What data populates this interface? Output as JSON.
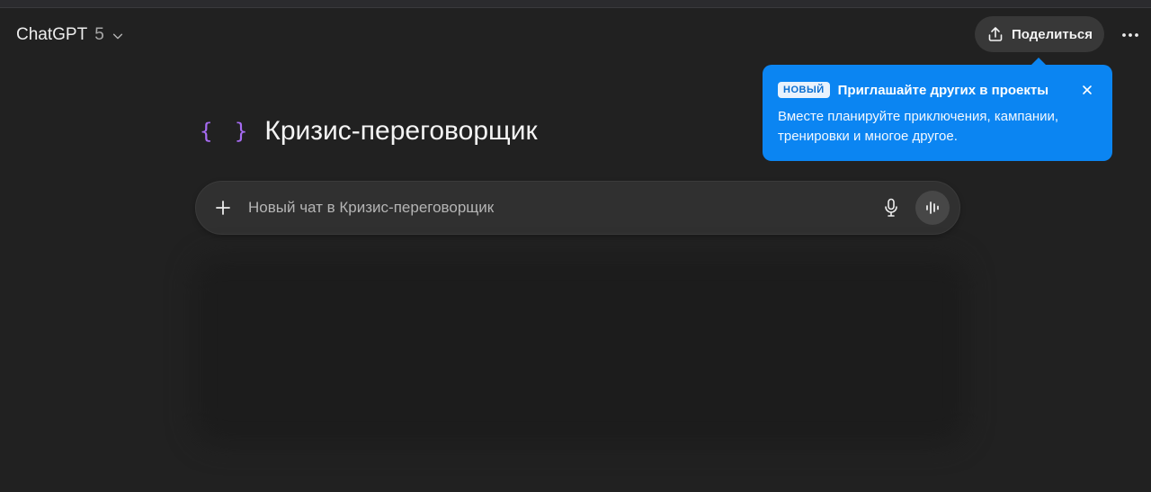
{
  "header": {
    "model_name": "ChatGPT",
    "model_version": "5",
    "share_label": "Поделиться",
    "icons": {
      "chevron": "chevron-down-icon",
      "share": "share-upload-icon",
      "more": "more-horizontal-icon"
    }
  },
  "tooltip": {
    "badge": "НОВЫЙ",
    "title": "Приглашайте других в проекты",
    "body": "Вместе планируйте приключения, кампании, тренировки и многое другое.",
    "bg_color": "#0b85f2"
  },
  "project": {
    "icon": "braces-icon",
    "icon_glyph": "{ }",
    "icon_color": "#a66bf2",
    "title": "Кризис-переговорщик"
  },
  "composer": {
    "placeholder": "Новый чат в Кризис-переговорщик",
    "icons": {
      "add": "plus-icon",
      "mic": "microphone-icon",
      "voice": "voice-waveform-icon"
    }
  },
  "colors": {
    "background": "#212121",
    "composer": "#303030",
    "share_button": "#383838"
  }
}
